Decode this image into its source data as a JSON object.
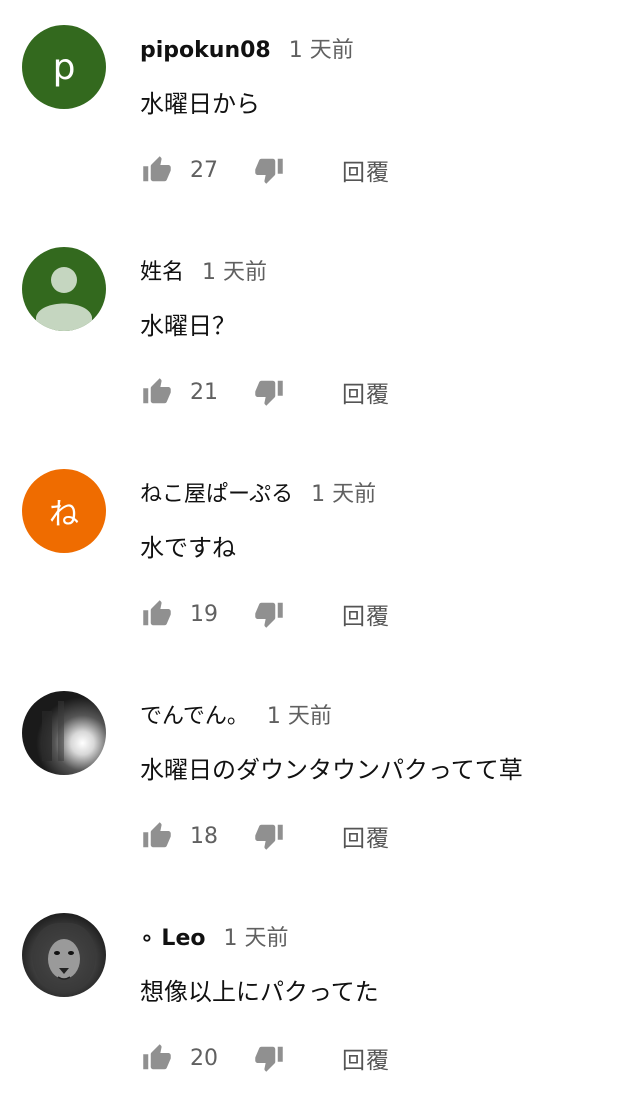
{
  "comments": [
    {
      "author": "pipokun08",
      "time": "1 天前",
      "text": "水曜日から",
      "likes": "27",
      "reply_label": "回覆",
      "avatar": {
        "type": "letter",
        "letter": "p",
        "color": "#33691e"
      }
    },
    {
      "author": "姓名",
      "time": "1 天前",
      "text": "水曜日？",
      "likes": "21",
      "reply_label": "回覆",
      "avatar": {
        "type": "default-person",
        "color": "#33691e"
      }
    },
    {
      "author": "ねこ屋ぱーぷる",
      "time": "1 天前",
      "text": "水ですね",
      "likes": "19",
      "reply_label": "回覆",
      "avatar": {
        "type": "letter",
        "letter": "ね",
        "color": "#ef6c00"
      }
    },
    {
      "author": "でんでん。",
      "time": "1 天前",
      "text": "水曜日のダウンタウンパクってて草",
      "likes": "18",
      "reply_label": "回覆",
      "avatar": {
        "type": "photo-dark-light"
      }
    },
    {
      "author": "∘ Leo",
      "time": "1 天前",
      "text": "想像以上にパクってた",
      "likes": "20",
      "reply_label": "回覆",
      "avatar": {
        "type": "photo-lion"
      }
    }
  ],
  "icons": {
    "like": "thumbs-up-icon",
    "dislike": "thumbs-down-icon"
  },
  "colors": {
    "icon_gray": "#909090",
    "meta_gray": "#606060"
  }
}
